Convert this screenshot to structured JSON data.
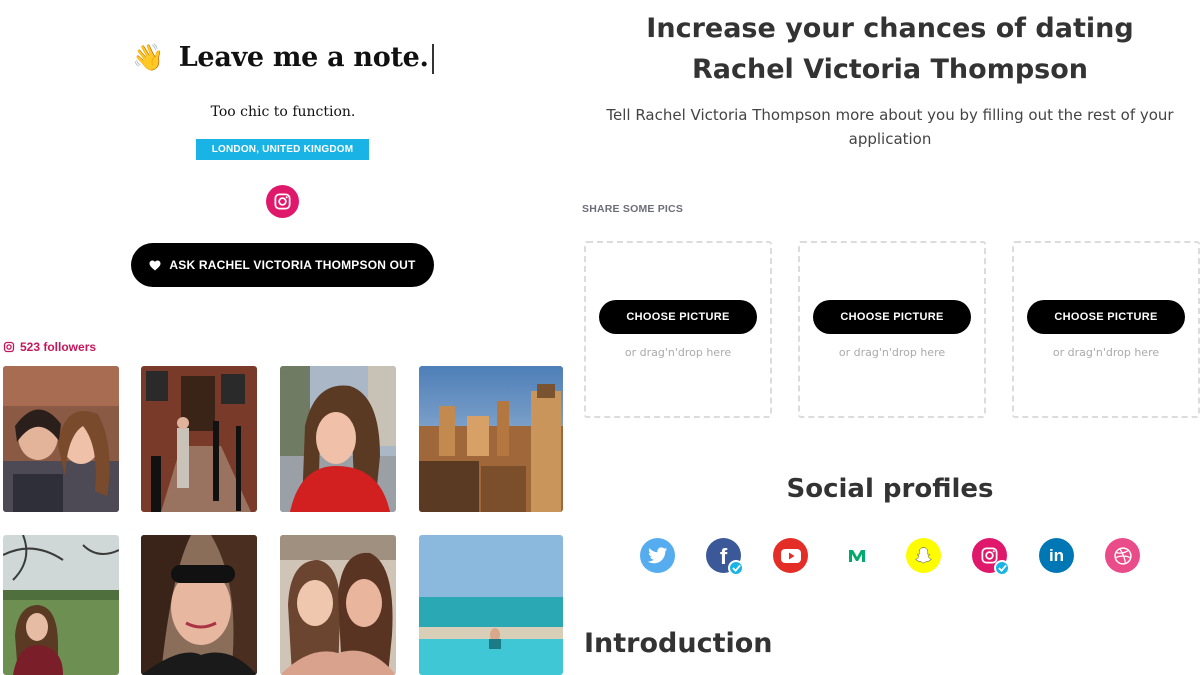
{
  "profile": {
    "note_emoji": "👋",
    "note_title": "Leave me a note.",
    "tagline": "Too chic to function.",
    "location": "LONDON, UNITED KINGDOM",
    "ask_button": "ASK RACHEL VICTORIA THOMPSON OUT",
    "followers": "523 followers"
  },
  "application": {
    "heading": "Increase your chances of dating Rachel Victoria Thompson",
    "subtext": "Tell Rachel Victoria Thompson more about you by filling out the rest of your application",
    "share_label": "SHARE SOME PICS",
    "uploads": [
      {
        "button": "CHOOSE PICTURE",
        "hint": "or drag'n'drop here"
      },
      {
        "button": "CHOOSE PICTURE",
        "hint": "or drag'n'drop here"
      },
      {
        "button": "CHOOSE PICTURE",
        "hint": "or drag'n'drop here"
      }
    ],
    "social_title": "Social profiles",
    "social_icons": [
      {
        "name": "twitter-icon",
        "color": "#55acee",
        "connected": false
      },
      {
        "name": "facebook-icon",
        "color": "#3b5998",
        "connected": true
      },
      {
        "name": "youtube-icon",
        "color": "#e52d27",
        "connected": false
      },
      {
        "name": "medium-icon",
        "color": "#00ab6c",
        "connected": false
      },
      {
        "name": "snapchat-icon",
        "color": "#fffc00",
        "connected": false
      },
      {
        "name": "instagram-icon",
        "color": "#e0186c",
        "connected": true
      },
      {
        "name": "linkedin-icon",
        "color": "#0077b5",
        "connected": false
      },
      {
        "name": "dribbble-icon",
        "color": "#ea4c89",
        "connected": false
      }
    ],
    "intro_title": "Introduction"
  },
  "colors": {
    "accent_blue": "#1ab3e6",
    "instagram_pink": "#e0186c",
    "followers_text": "#c2185b"
  }
}
